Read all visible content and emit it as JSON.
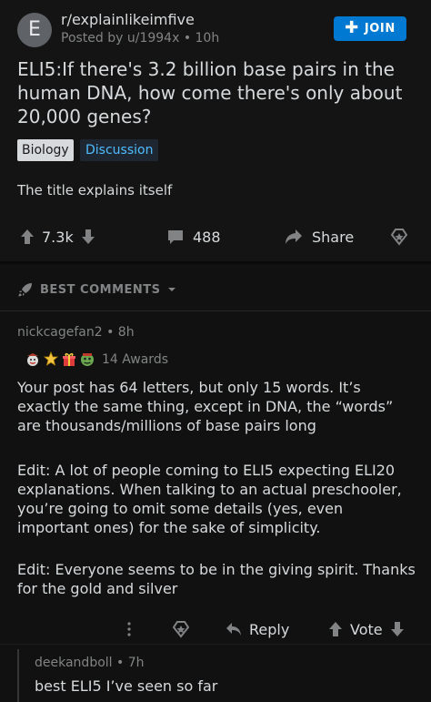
{
  "post": {
    "avatar_letter": "E",
    "subreddit": "r/explainlikeimfive",
    "posted_by": "Posted by u/1994x • 10h",
    "join_label": "JOIN",
    "title": "ELI5:If there's 3.2 billion base pairs in the human DNA, how come there's only about 20,000 genes?",
    "flairs": [
      "Biology",
      "Discussion"
    ],
    "selftext": "The title explains itself",
    "votes": "7.3k",
    "comments": "488",
    "share_label": "Share"
  },
  "sort": {
    "label": "BEST COMMENTS"
  },
  "comment": {
    "author_meta": "nickcagefan2 • 8h",
    "awards_count": "14 Awards",
    "paragraphs": [
      "Your post has 64 letters, but only 15 words. It’s exactly the same thing, except in DNA, the “words” are thousands/millions of base pairs long",
      "Edit: A lot of people coming to ELI5 expecting ELI20 explanations. When talking to an actual preschooler, you’re going to omit some details (yes, even important ones) for the sake of simplicity.",
      "Edit: Everyone seems to be in the giving spirit. Thanks for the gold and silver"
    ],
    "reply_label": "Reply",
    "vote_label": "Vote"
  },
  "reply": {
    "author_meta": "deekandboll • 7h",
    "body": "best ELI5 I’ve seen so far"
  },
  "colors": {
    "accent": "#0079d3",
    "flair_discussion_text": "#4fbcff",
    "background": "#111111"
  },
  "icons": [
    "upvote-icon",
    "downvote-icon",
    "comment-icon",
    "share-icon",
    "award-icon",
    "rocket-icon",
    "chevron-down-icon",
    "more-icon",
    "reply-icon",
    "plus-icon"
  ]
}
